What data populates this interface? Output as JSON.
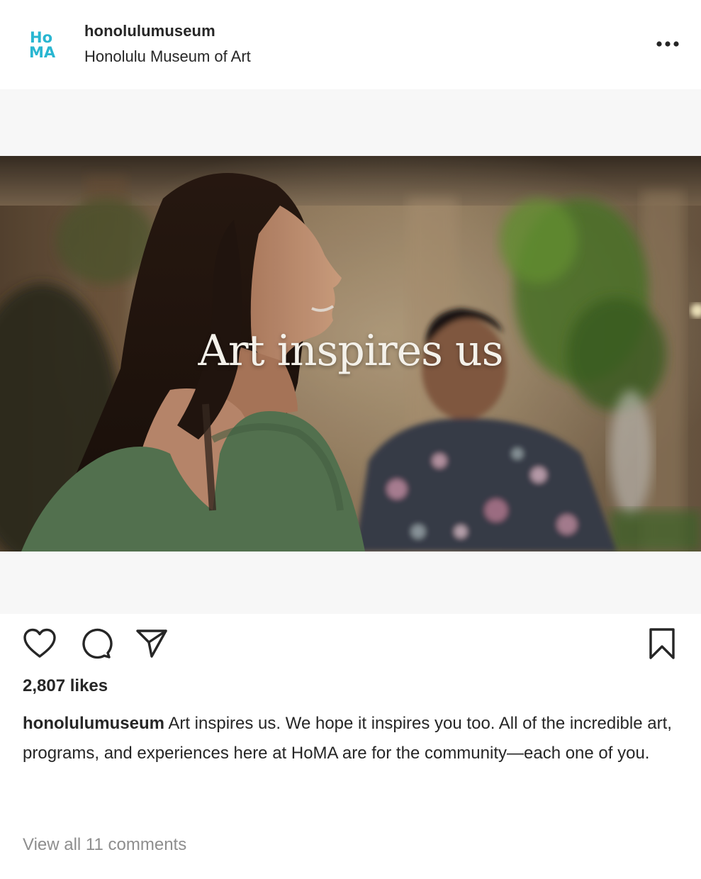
{
  "post": {
    "account": {
      "username": "honolulumuseum",
      "location": "Honolulu Museum of Art",
      "logo": {
        "top_text": "Ho",
        "bottom_text": "MA",
        "color": "#29b6d1"
      }
    },
    "more_icon": "more-horizontal-icon",
    "media": {
      "overlay_text": "Art inspires us"
    },
    "actions": {
      "like_icon": "heart-icon",
      "comment_icon": "comment-icon",
      "share_icon": "send-icon",
      "save_icon": "bookmark-icon"
    },
    "likes": "2,807 likes",
    "caption": {
      "username": "honolulumuseum",
      "text": "Art inspires us. We hope it inspires you too. All of the incredible art, programs, and experiences here at HoMA are for the community—each one of you."
    },
    "view_comments": "View all 11 comments"
  },
  "colors": {
    "text_primary": "#262626",
    "text_secondary": "#8e8e8e",
    "media_background": "#f7f7f7",
    "logo_accent": "#29b6d1"
  }
}
